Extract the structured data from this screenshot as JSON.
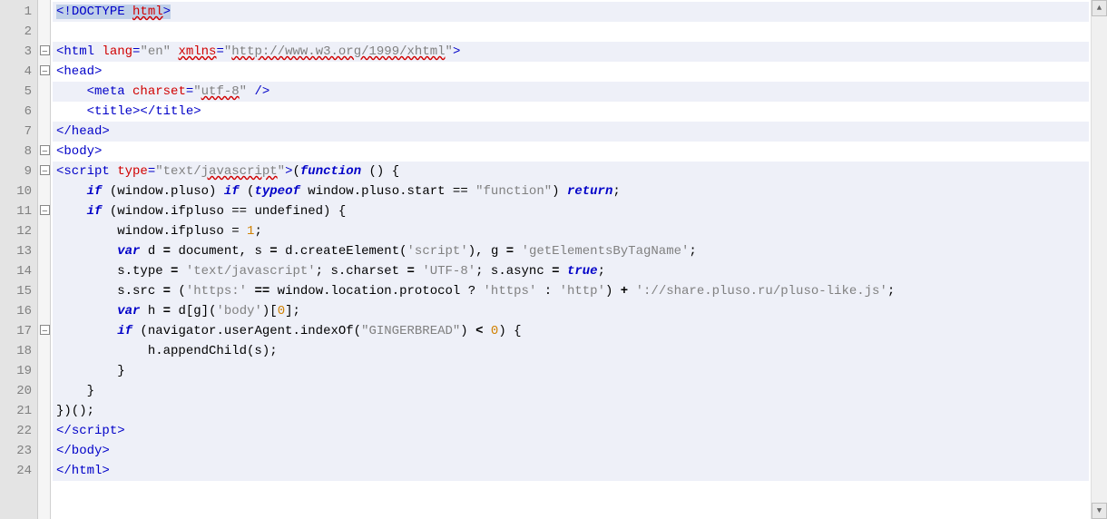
{
  "lineCount": 24,
  "lines": [
    {
      "n": 1,
      "fold": "",
      "hl": true,
      "sel": true,
      "tokens": [
        {
          "t": "<!",
          "c": "k",
          "sel": true
        },
        {
          "t": "DOCTYPE",
          "c": "k",
          "sel": true
        },
        {
          "t": " ",
          "sel": true
        },
        {
          "t": "html",
          "c": "attr underline",
          "sel": true
        },
        {
          "t": ">",
          "c": "k",
          "sel": true
        }
      ]
    },
    {
      "n": 2,
      "fold": "",
      "hl": false,
      "tokens": []
    },
    {
      "n": 3,
      "fold": "box",
      "hl": true,
      "tokens": [
        {
          "t": "<html ",
          "c": "k"
        },
        {
          "t": "lang",
          "c": "attr"
        },
        {
          "t": "=",
          "c": "k"
        },
        {
          "t": "\"en\"",
          "c": "str"
        },
        {
          "t": " ",
          "c": "k"
        },
        {
          "t": "xmlns",
          "c": "attr underline"
        },
        {
          "t": "=",
          "c": "k"
        },
        {
          "t": "\"",
          "c": "str"
        },
        {
          "t": "http://www.w3.org/1999/xhtml",
          "c": "str underline"
        },
        {
          "t": "\"",
          "c": "str"
        },
        {
          "t": ">",
          "c": "k"
        }
      ]
    },
    {
      "n": 4,
      "fold": "box",
      "hl": false,
      "tokens": [
        {
          "t": "<head>",
          "c": "k"
        }
      ]
    },
    {
      "n": 5,
      "fold": "",
      "hl": true,
      "tokens": [
        {
          "t": "    "
        },
        {
          "t": "<meta ",
          "c": "k"
        },
        {
          "t": "charset",
          "c": "attr"
        },
        {
          "t": "=",
          "c": "k"
        },
        {
          "t": "\"",
          "c": "str"
        },
        {
          "t": "utf-8",
          "c": "str underline"
        },
        {
          "t": "\"",
          "c": "str"
        },
        {
          "t": " />",
          "c": "k"
        }
      ]
    },
    {
      "n": 6,
      "fold": "",
      "hl": false,
      "tokens": [
        {
          "t": "    "
        },
        {
          "t": "<title></title>",
          "c": "k"
        }
      ]
    },
    {
      "n": 7,
      "fold": "",
      "hl": true,
      "tokens": [
        {
          "t": "</head>",
          "c": "k"
        }
      ]
    },
    {
      "n": 8,
      "fold": "box",
      "hl": false,
      "tokens": [
        {
          "t": "<body>",
          "c": "k"
        }
      ]
    },
    {
      "n": 9,
      "fold": "box",
      "hl": true,
      "tokens": [
        {
          "t": "<script ",
          "c": "k"
        },
        {
          "t": "type",
          "c": "attr"
        },
        {
          "t": "=",
          "c": "k"
        },
        {
          "t": "\"text/",
          "c": "str"
        },
        {
          "t": "javascript",
          "c": "str underline"
        },
        {
          "t": "\"",
          "c": "str"
        },
        {
          "t": ">",
          "c": "k"
        },
        {
          "t": "(",
          "c": "txt"
        },
        {
          "t": "function",
          "c": "b"
        },
        {
          "t": " () {",
          "c": "txt"
        }
      ]
    },
    {
      "n": 10,
      "fold": "",
      "hl": true,
      "tokens": [
        {
          "t": "    "
        },
        {
          "t": "if",
          "c": "b"
        },
        {
          "t": " (window.pluso) ",
          "c": "txt"
        },
        {
          "t": "if",
          "c": "b"
        },
        {
          "t": " (",
          "c": "txt"
        },
        {
          "t": "typeof",
          "c": "b"
        },
        {
          "t": " window.pluso.start == ",
          "c": "txt"
        },
        {
          "t": "\"function\"",
          "c": "str"
        },
        {
          "t": ") ",
          "c": "txt"
        },
        {
          "t": "return",
          "c": "b"
        },
        {
          "t": ";",
          "c": "txt"
        }
      ]
    },
    {
      "n": 11,
      "fold": "box",
      "hl": true,
      "tokens": [
        {
          "t": "    "
        },
        {
          "t": "if",
          "c": "b"
        },
        {
          "t": " (window.ifpluso == undefined) {",
          "c": "txt"
        }
      ]
    },
    {
      "n": 12,
      "fold": "",
      "hl": true,
      "tokens": [
        {
          "t": "        window.ifpluso = ",
          "c": "txt"
        },
        {
          "t": "1",
          "c": "num"
        },
        {
          "t": ";",
          "c": "txt"
        }
      ]
    },
    {
      "n": 13,
      "fold": "",
      "hl": true,
      "tokens": [
        {
          "t": "        "
        },
        {
          "t": "var",
          "c": "b"
        },
        {
          "t": " d ",
          "c": "txt"
        },
        {
          "t": "=",
          "c": "op"
        },
        {
          "t": " document, s ",
          "c": "txt"
        },
        {
          "t": "=",
          "c": "op"
        },
        {
          "t": " d.createElement(",
          "c": "txt"
        },
        {
          "t": "'script'",
          "c": "str"
        },
        {
          "t": "), g ",
          "c": "txt"
        },
        {
          "t": "=",
          "c": "op"
        },
        {
          "t": " ",
          "c": "txt"
        },
        {
          "t": "'getElementsByTagName'",
          "c": "str"
        },
        {
          "t": ";",
          "c": "txt"
        }
      ]
    },
    {
      "n": 14,
      "fold": "",
      "hl": true,
      "tokens": [
        {
          "t": "        s.type ",
          "c": "txt"
        },
        {
          "t": "=",
          "c": "op"
        },
        {
          "t": " ",
          "c": "txt"
        },
        {
          "t": "'text/javascript'",
          "c": "str"
        },
        {
          "t": "; s.charset ",
          "c": "txt"
        },
        {
          "t": "=",
          "c": "op"
        },
        {
          "t": " ",
          "c": "txt"
        },
        {
          "t": "'UTF-8'",
          "c": "str"
        },
        {
          "t": "; s.async ",
          "c": "txt"
        },
        {
          "t": "=",
          "c": "op"
        },
        {
          "t": " ",
          "c": "txt"
        },
        {
          "t": "true",
          "c": "b"
        },
        {
          "t": ";",
          "c": "txt"
        }
      ]
    },
    {
      "n": 15,
      "fold": "",
      "hl": true,
      "tokens": [
        {
          "t": "        s.src ",
          "c": "txt"
        },
        {
          "t": "=",
          "c": "op"
        },
        {
          "t": " (",
          "c": "txt"
        },
        {
          "t": "'https:'",
          "c": "str"
        },
        {
          "t": " ",
          "c": "txt"
        },
        {
          "t": "==",
          "c": "op"
        },
        {
          "t": " window.location.protocol ? ",
          "c": "txt"
        },
        {
          "t": "'https'",
          "c": "str"
        },
        {
          "t": " : ",
          "c": "txt"
        },
        {
          "t": "'http'",
          "c": "str"
        },
        {
          "t": ") ",
          "c": "txt"
        },
        {
          "t": "+",
          "c": "op"
        },
        {
          "t": " ",
          "c": "txt"
        },
        {
          "t": "'://share.pluso.ru/pluso-like.js'",
          "c": "str"
        },
        {
          "t": ";",
          "c": "txt"
        }
      ]
    },
    {
      "n": 16,
      "fold": "",
      "hl": true,
      "tokens": [
        {
          "t": "        "
        },
        {
          "t": "var",
          "c": "b"
        },
        {
          "t": " h ",
          "c": "txt"
        },
        {
          "t": "=",
          "c": "op"
        },
        {
          "t": " d[g](",
          "c": "txt"
        },
        {
          "t": "'body'",
          "c": "str"
        },
        {
          "t": ")[",
          "c": "txt"
        },
        {
          "t": "0",
          "c": "num"
        },
        {
          "t": "];",
          "c": "txt"
        }
      ]
    },
    {
      "n": 17,
      "fold": "box",
      "hl": true,
      "tokens": [
        {
          "t": "        "
        },
        {
          "t": "if",
          "c": "b"
        },
        {
          "t": " (navigator.userAgent.indexOf(",
          "c": "txt"
        },
        {
          "t": "\"GINGERBREAD\"",
          "c": "str"
        },
        {
          "t": ") ",
          "c": "txt"
        },
        {
          "t": "<",
          "c": "op"
        },
        {
          "t": " ",
          "c": "txt"
        },
        {
          "t": "0",
          "c": "num"
        },
        {
          "t": ") {",
          "c": "txt"
        }
      ]
    },
    {
      "n": 18,
      "fold": "",
      "hl": true,
      "tokens": [
        {
          "t": "            h.appendChild(s);",
          "c": "txt"
        }
      ]
    },
    {
      "n": 19,
      "fold": "",
      "hl": true,
      "tokens": [
        {
          "t": "        }",
          "c": "txt"
        }
      ]
    },
    {
      "n": 20,
      "fold": "",
      "hl": true,
      "tokens": [
        {
          "t": "    }",
          "c": "txt"
        }
      ]
    },
    {
      "n": 21,
      "fold": "",
      "hl": true,
      "tokens": [
        {
          "t": "})();",
          "c": "txt"
        }
      ]
    },
    {
      "n": 22,
      "fold": "",
      "hl": true,
      "tokens": [
        {
          "t": "<",
          "c": "k"
        },
        {
          "t": "/",
          "c": "k"
        },
        {
          "t": "script",
          "c": "k"
        },
        {
          "t": ">",
          "c": "k"
        }
      ]
    },
    {
      "n": 23,
      "fold": "",
      "hl": true,
      "tokens": [
        {
          "t": "</body>",
          "c": "k"
        }
      ]
    },
    {
      "n": 24,
      "fold": "",
      "hl": true,
      "tokens": [
        {
          "t": "</html>",
          "c": "k"
        }
      ]
    }
  ],
  "scrollbar": {
    "up": "▲",
    "down": "▼"
  }
}
